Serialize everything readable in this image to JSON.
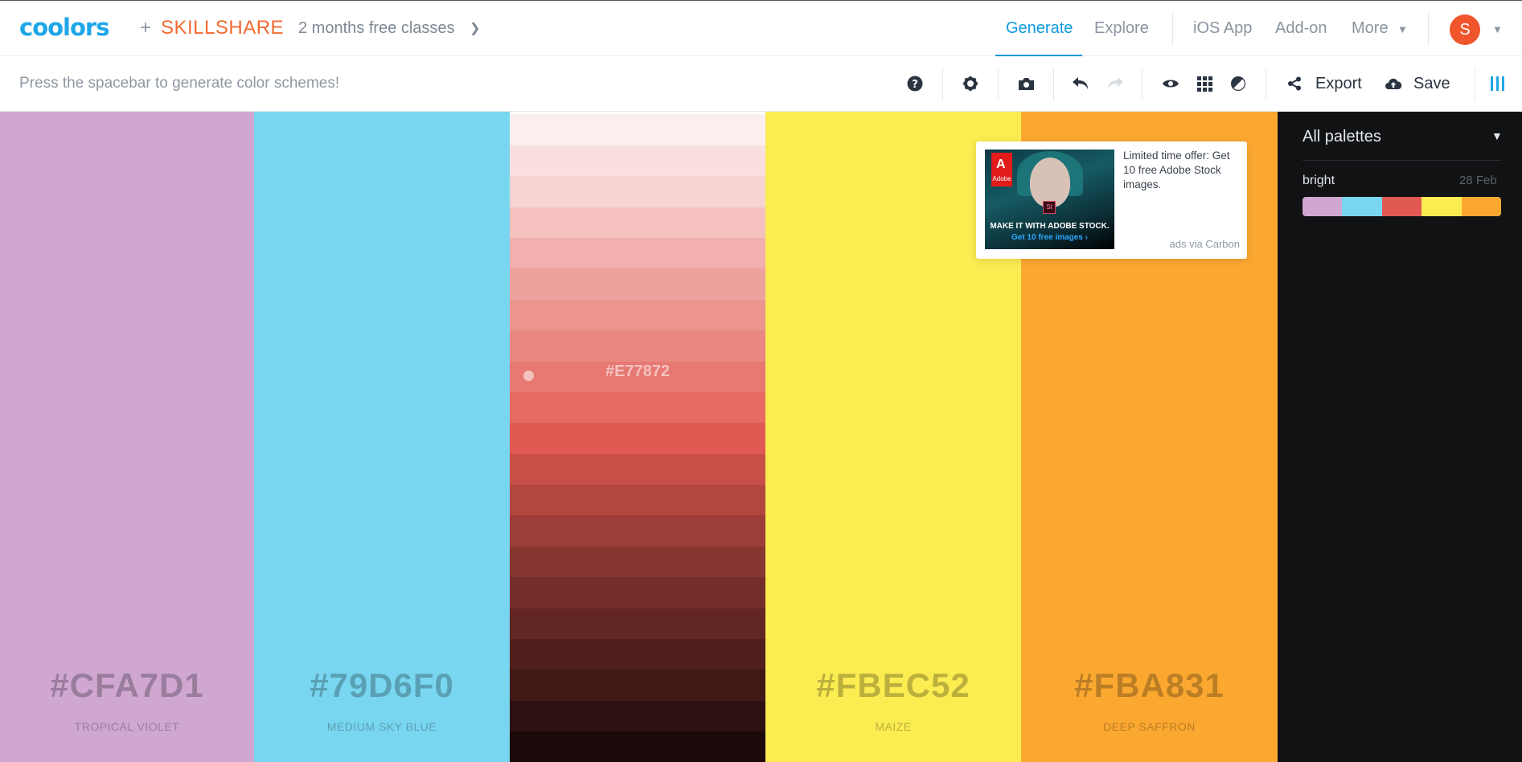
{
  "topbar": {
    "logo": "coolors",
    "plus": "+",
    "partner_brand": "SKILLSHARE",
    "promo": "2 months free classes",
    "nav": {
      "generate": "Generate",
      "explore": "Explore",
      "ios_app": "iOS App",
      "addon": "Add-on",
      "more": "More"
    },
    "avatar_initial": "S"
  },
  "toolbar": {
    "hint": "Press the spacebar to generate color schemes!",
    "export_label": "Export",
    "save_label": "Save",
    "icons": [
      "help-icon",
      "gear-icon",
      "camera-icon",
      "undo-icon",
      "redo-icon",
      "eye-icon",
      "grid-icon",
      "contrast-icon",
      "share-icon",
      "cloud-upload-icon",
      "columns-icon"
    ]
  },
  "palette": {
    "colors": [
      {
        "hex": "#CFA7D1",
        "name": "TROPICAL VIOLET",
        "text_color": "#9a7d9c"
      },
      {
        "hex": "#79D6F0",
        "name": "MEDIUM SKY BLUE",
        "text_color": "#5aa0b4"
      },
      {
        "hex": "#E77872",
        "name": "",
        "text_color": "#ffffff"
      },
      {
        "hex": "#FBEC52",
        "name": "MAIZE",
        "text_color": "#bcb03d"
      },
      {
        "hex": "#FBA831",
        "name": "DEEP SAFFRON",
        "text_color": "#bc7e25"
      }
    ],
    "shades_column": {
      "selected_hex": "#E77872",
      "selected_index": 8,
      "shades": [
        "#fbefee",
        "#f9e0df",
        "#f7d3d1",
        "#f4c1bf",
        "#f1b0ad",
        "#eea29e",
        "#ec958f",
        "#e98781",
        "#e77872",
        "#e66b65",
        "#e05a53",
        "#c94f49",
        "#b3463f",
        "#9d3e38",
        "#873631",
        "#742e29",
        "#632723",
        "#51201d",
        "#401917",
        "#2e1211",
        "#1b0a09"
      ]
    }
  },
  "ad": {
    "brand_mark": "Adobe",
    "image_headline": "MAKE IT WITH ADOBE STOCK.",
    "image_cta": "Get 10 free images ›",
    "text": "Limited time offer: Get 10 free Adobe Stock images.",
    "via": "ads via Carbon"
  },
  "sidebar": {
    "title": "All palettes",
    "palette": {
      "name": "bright",
      "date": "28 Feb",
      "swatches": [
        "#CFA7D1",
        "#79D6F0",
        "#E05A53",
        "#FBEC52",
        "#FBA831"
      ]
    }
  }
}
